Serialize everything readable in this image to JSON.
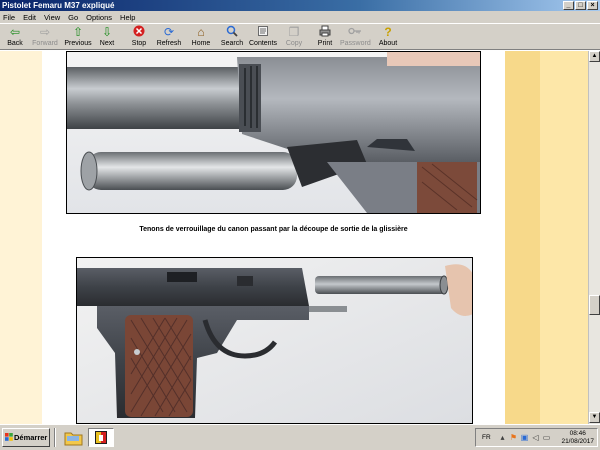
{
  "window": {
    "title": "Pistolet Femaru M37 expliqué"
  },
  "menu": [
    "File",
    "Edit",
    "View",
    "Go",
    "Options",
    "Help"
  ],
  "toolbar": {
    "buttons": [
      {
        "label": "Back",
        "icon": "arrow-left-icon",
        "color": "#1a8a1a",
        "disabled": false
      },
      {
        "label": "Forward",
        "icon": "arrow-right-icon",
        "color": "#9a9a9a",
        "disabled": true
      },
      {
        "label": "Previous",
        "icon": "arrow-up-icon",
        "color": "#1a8a1a",
        "disabled": false
      },
      {
        "label": "Next",
        "icon": "arrow-down-icon",
        "color": "#1a8a1a",
        "disabled": false
      },
      {
        "label": "Stop",
        "icon": "stop-icon",
        "color": "#d42020",
        "disabled": false
      },
      {
        "label": "Refresh",
        "icon": "refresh-icon",
        "color": "#2a6ad4",
        "disabled": false
      },
      {
        "label": "Home",
        "icon": "home-icon",
        "color": "#8a5a1a",
        "disabled": false
      },
      {
        "label": "Search",
        "icon": "search-icon",
        "color": "#2a6ad4",
        "disabled": false
      },
      {
        "label": "Contents",
        "icon": "contents-icon",
        "color": "#6a6a6a",
        "disabled": false
      },
      {
        "label": "Copy",
        "icon": "copy-icon",
        "color": "#a0a0a0",
        "disabled": true
      },
      {
        "label": "Print",
        "icon": "print-icon",
        "color": "#404040",
        "disabled": false
      },
      {
        "label": "Password",
        "icon": "key-icon",
        "color": "#a0a0a0",
        "disabled": true
      },
      {
        "label": "About",
        "icon": "question-icon",
        "color": "#c8a000",
        "disabled": false
      }
    ]
  },
  "document": {
    "caption1": "Tenons de verrouillage du canon passant par la découpe de sortie de la glissière"
  },
  "taskbar": {
    "start_label": "Démarrer",
    "language": "FR",
    "time": "08:46",
    "date": "21/08/2017"
  },
  "colors": {
    "title_bar": "#0a246a",
    "chrome": "#d4d0c8",
    "band_left": "#fff3d6",
    "band_right_dark": "#f7d98a",
    "band_right_light": "#fde7a8"
  }
}
